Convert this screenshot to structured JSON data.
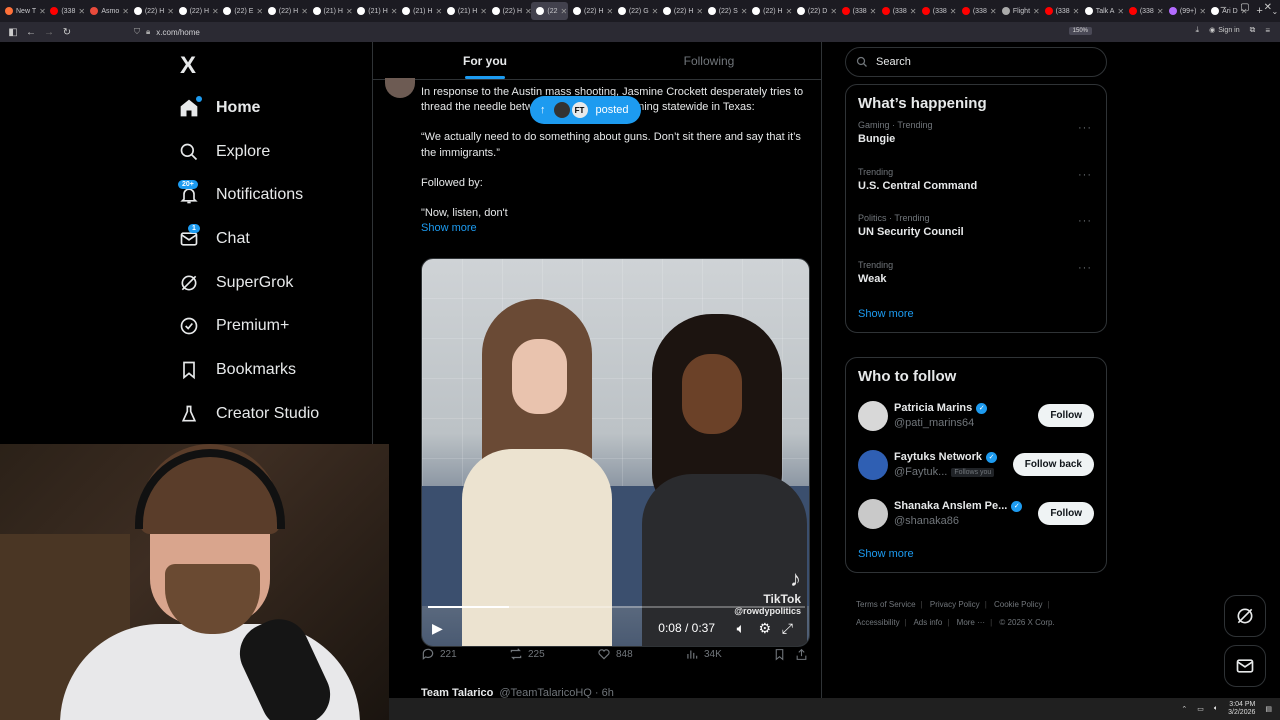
{
  "browser": {
    "tabs": [
      {
        "label": "New T",
        "color": "#ff7139"
      },
      {
        "label": "(338",
        "color": "#ff0000"
      },
      {
        "label": "Asmo",
        "color": "#e94b3c"
      },
      {
        "label": "(22) H",
        "color": "#ffffff"
      },
      {
        "label": "(22) H",
        "color": "#ffffff"
      },
      {
        "label": "(22) E",
        "color": "#ffffff"
      },
      {
        "label": "(22) H",
        "color": "#ffffff"
      },
      {
        "label": "(21) H",
        "color": "#ffffff"
      },
      {
        "label": "(21) H",
        "color": "#ffffff"
      },
      {
        "label": "(21) H",
        "color": "#ffffff"
      },
      {
        "label": "(21) H",
        "color": "#ffffff"
      },
      {
        "label": "(22) H",
        "color": "#ffffff"
      },
      {
        "label": "(22",
        "color": "#ffffff",
        "active": true
      },
      {
        "label": "(22) H",
        "color": "#ffffff"
      },
      {
        "label": "(22) G",
        "color": "#ffffff"
      },
      {
        "label": "(22) H",
        "color": "#ffffff"
      },
      {
        "label": "(22) S",
        "color": "#ffffff"
      },
      {
        "label": "(22) H",
        "color": "#ffffff"
      },
      {
        "label": "(22) D",
        "color": "#ffffff"
      },
      {
        "label": "(338",
        "color": "#ff0000"
      },
      {
        "label": "(338",
        "color": "#ff0000"
      },
      {
        "label": "(338",
        "color": "#ff0000"
      },
      {
        "label": "(338",
        "color": "#ff0000"
      },
      {
        "label": "Flight",
        "color": "#aaaaaa"
      },
      {
        "label": "(338",
        "color": "#ff0000"
      },
      {
        "label": "Talk A",
        "color": "#ffffff"
      },
      {
        "label": "(338",
        "color": "#ff0000"
      },
      {
        "label": "(99+)",
        "color": "#b36bff"
      },
      {
        "label": "Ari D",
        "color": "#ffffff"
      }
    ],
    "url": "x.com/home",
    "zoom": "150%",
    "sign_in": "Sign in"
  },
  "nav": {
    "logo": "X",
    "items": [
      {
        "label": "Home",
        "icon": "home-icon",
        "active": true
      },
      {
        "label": "Explore",
        "icon": "search-icon"
      },
      {
        "label": "Notifications",
        "icon": "bell-icon",
        "badge": "20+"
      },
      {
        "label": "Chat",
        "icon": "mail-icon",
        "badge": "1"
      },
      {
        "label": "SuperGrok",
        "icon": "grok-icon"
      },
      {
        "label": "Premium+",
        "icon": "verified-icon"
      },
      {
        "label": "Bookmarks",
        "icon": "bookmark-icon"
      },
      {
        "label": "Creator Studio",
        "icon": "flask-icon"
      }
    ]
  },
  "feed": {
    "tabs": [
      "For you",
      "Following"
    ],
    "selected_tab": "For you",
    "posted_pill": {
      "label": "posted",
      "avatar_b": "FT"
    },
    "tweet": {
      "para1": "In response to the Austin mass shooting, Jasmine Crockett desperately tries to thread the needle between her base and winning statewide in Texas:",
      "para2": "“We actually need to do something about guns. Don’t sit there and say that it’s the immigrants.”",
      "para3": "Followed by:",
      "para4": "\"Now, listen, don't",
      "show_more": "Show more",
      "video": {
        "time": "0:08 / 0:37",
        "watermark": "TikTok",
        "handle": "@rowdypolitics",
        "progress": 0.216
      },
      "replies": "221",
      "reposts": "225",
      "likes": "848",
      "views": "34K"
    },
    "next_tweet": {
      "name": "Team Talarico",
      "handle": "@TeamTalaricoHQ · 6h"
    }
  },
  "sidebar": {
    "search_placeholder": "Search",
    "happening": {
      "title": "What’s happening",
      "trends": [
        {
          "context": "Gaming · Trending",
          "name": "Bungie"
        },
        {
          "context": "Trending",
          "name": "U.S. Central Command"
        },
        {
          "context": "Politics · Trending",
          "name": "UN Security Council"
        },
        {
          "context": "Trending",
          "name": "Weak"
        }
      ],
      "show_more": "Show more"
    },
    "who_to_follow": {
      "title": "Who to follow",
      "accounts": [
        {
          "name": "Patricia Marins",
          "handle": "@pati_marins64",
          "button": "Follow",
          "avatar_color": "#d8d8d8"
        },
        {
          "name": "Faytuks Network",
          "handle": "@Faytuk...",
          "follows_you": "Follows you",
          "button": "Follow back",
          "avatar_color": "#2f5fb3"
        },
        {
          "name": "Shanaka Anslem Pe...",
          "handle": "@shanaka86",
          "button": "Follow",
          "avatar_color": "#c9c9c9"
        }
      ],
      "show_more": "Show more"
    },
    "footer": [
      "Terms of Service",
      "Privacy Policy",
      "Cookie Policy",
      "Accessibility",
      "Ads info",
      "More ···",
      "© 2026 X Corp."
    ]
  },
  "taskbar": {
    "time": "3:04 PM",
    "date": "3/2/2026"
  }
}
